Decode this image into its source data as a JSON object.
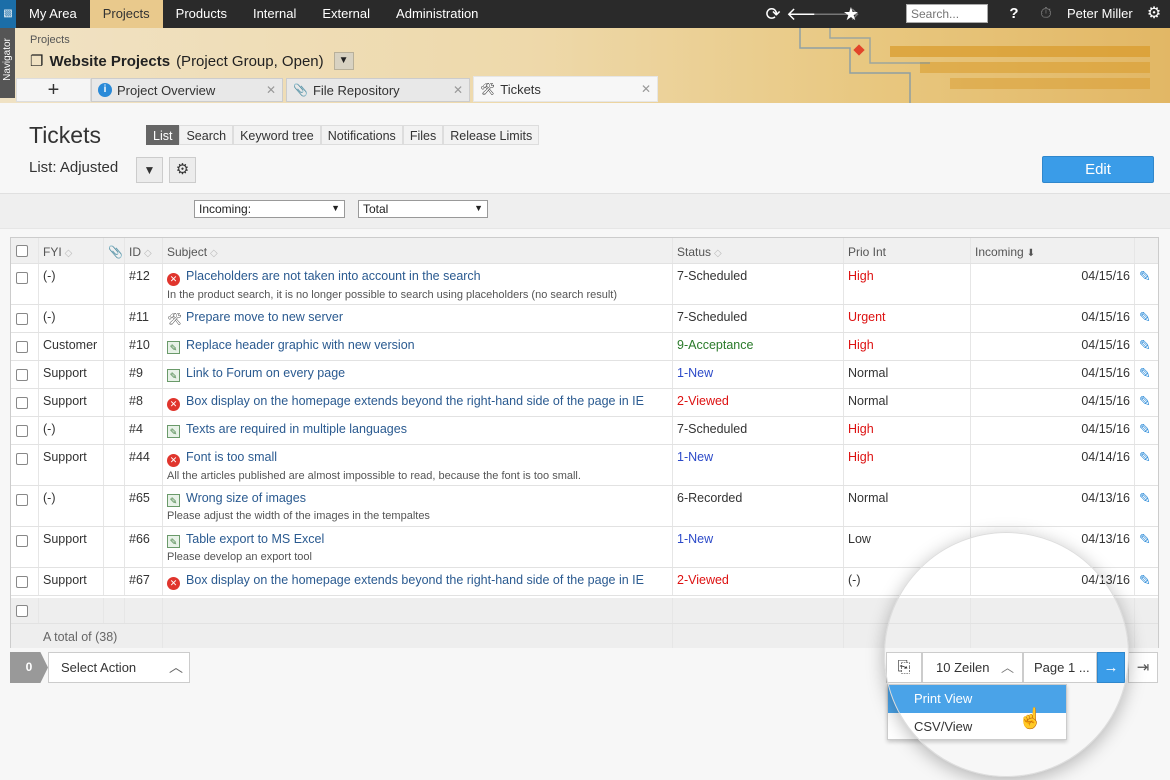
{
  "topnav": {
    "logo": "▧",
    "items": [
      "My Area",
      "Projects",
      "Products",
      "Internal",
      "External",
      "Administration"
    ],
    "active": "Projects",
    "search_placeholder": "Search...",
    "help": "?",
    "user": "Peter Miller"
  },
  "navigator": {
    "label": "Navigator"
  },
  "header": {
    "breadcrumb": "Projects",
    "title_bold": "Website Projects",
    "title_rest": "(Project Group, Open)"
  },
  "tabs": [
    {
      "label": "Project Overview",
      "icon": "info-icon"
    },
    {
      "label": "File Repository",
      "icon": "paperclip-icon"
    },
    {
      "label": "Tickets",
      "icon": "tools-icon"
    }
  ],
  "page": {
    "title": "Tickets",
    "subtabs": [
      "List",
      "Search",
      "Keyword tree",
      "Notifications",
      "Files",
      "Release Limits"
    ],
    "active_subtab": "List",
    "list_name": "List: Adjusted",
    "edit_label": "Edit"
  },
  "filters": {
    "incoming": "Incoming:",
    "total": "Total"
  },
  "table": {
    "columns": {
      "fyi": "FYI",
      "id": "ID",
      "subject": "Subject",
      "status": "Status",
      "prio": "Prio Int",
      "incoming": "Incoming"
    },
    "rows": [
      {
        "fyi": "(-)",
        "id": "#12",
        "subject": "Placeholders are not taken into account in the search",
        "desc": "In the product search, it is no longer possible to search using placeholders (no search result)",
        "status": "7-Scheduled",
        "prio": "High",
        "date": "04/15/16",
        "icon": "error-icon",
        "status_color": "",
        "prio_color": "red"
      },
      {
        "fyi": "(-)",
        "id": "#11",
        "subject": "Prepare move to new server",
        "desc": "",
        "status": "7-Scheduled",
        "prio": "Urgent",
        "date": "04/15/16",
        "icon": "tools-icon",
        "status_color": "",
        "prio_color": "red"
      },
      {
        "fyi": "Customer",
        "id": "#10",
        "subject": "Replace header graphic with new version",
        "desc": "",
        "status": "9-Acceptance",
        "prio": "High",
        "date": "04/15/16",
        "icon": "document-icon",
        "status_color": "green",
        "prio_color": "red"
      },
      {
        "fyi": "Support",
        "id": "#9",
        "subject": "Link to Forum on every page",
        "desc": "",
        "status": "1-New",
        "prio": "Normal",
        "date": "04/15/16",
        "icon": "document-icon",
        "status_color": "blue",
        "prio_color": ""
      },
      {
        "fyi": "Support",
        "id": "#8",
        "subject": "Box display on the homepage extends beyond the right-hand side of the page in IE",
        "desc": "",
        "status": "2-Viewed",
        "prio": "Normal",
        "date": "04/15/16",
        "icon": "error-icon",
        "status_color": "red",
        "prio_color": ""
      },
      {
        "fyi": "(-)",
        "id": "#4",
        "subject": "Texts are required in multiple languages",
        "desc": "",
        "status": "7-Scheduled",
        "prio": "High",
        "date": "04/15/16",
        "icon": "document-icon",
        "status_color": "",
        "prio_color": "red"
      },
      {
        "fyi": "Support",
        "id": "#44",
        "subject": "Font is too small",
        "desc": "All the articles published are almost impossible to read, because the font is too small.",
        "status": "1-New",
        "prio": "High",
        "date": "04/14/16",
        "icon": "error-icon",
        "status_color": "blue",
        "prio_color": "red"
      },
      {
        "fyi": "(-)",
        "id": "#65",
        "subject": "Wrong size of images",
        "desc": "Please adjust the width of the images in the tempaltes",
        "status": "6-Recorded",
        "prio": "Normal",
        "date": "04/13/16",
        "icon": "document-icon",
        "status_color": "",
        "prio_color": ""
      },
      {
        "fyi": "Support",
        "id": "#66",
        "subject": "Table export to MS Excel",
        "desc": "Please develop an export tool",
        "status": "1-New",
        "prio": "Low",
        "date": "04/13/16",
        "icon": "document-icon",
        "status_color": "blue",
        "prio_color": ""
      },
      {
        "fyi": "Support",
        "id": "#67",
        "subject": "Box display on the homepage extends beyond the right-hand side of the page in IE",
        "desc": "",
        "status": "2-Viewed",
        "prio": "(-)",
        "date": "04/13/16",
        "icon": "error-icon",
        "status_color": "red",
        "prio_color": ""
      }
    ],
    "total": "A total of (38)"
  },
  "footer": {
    "count": "0",
    "select_action": "Select Action",
    "rows_label": "10 Zeilen",
    "page_label": "Page 1 ..."
  },
  "popup": {
    "items": [
      "Print View",
      "CSV/View"
    ],
    "highlighted": "Print View"
  }
}
